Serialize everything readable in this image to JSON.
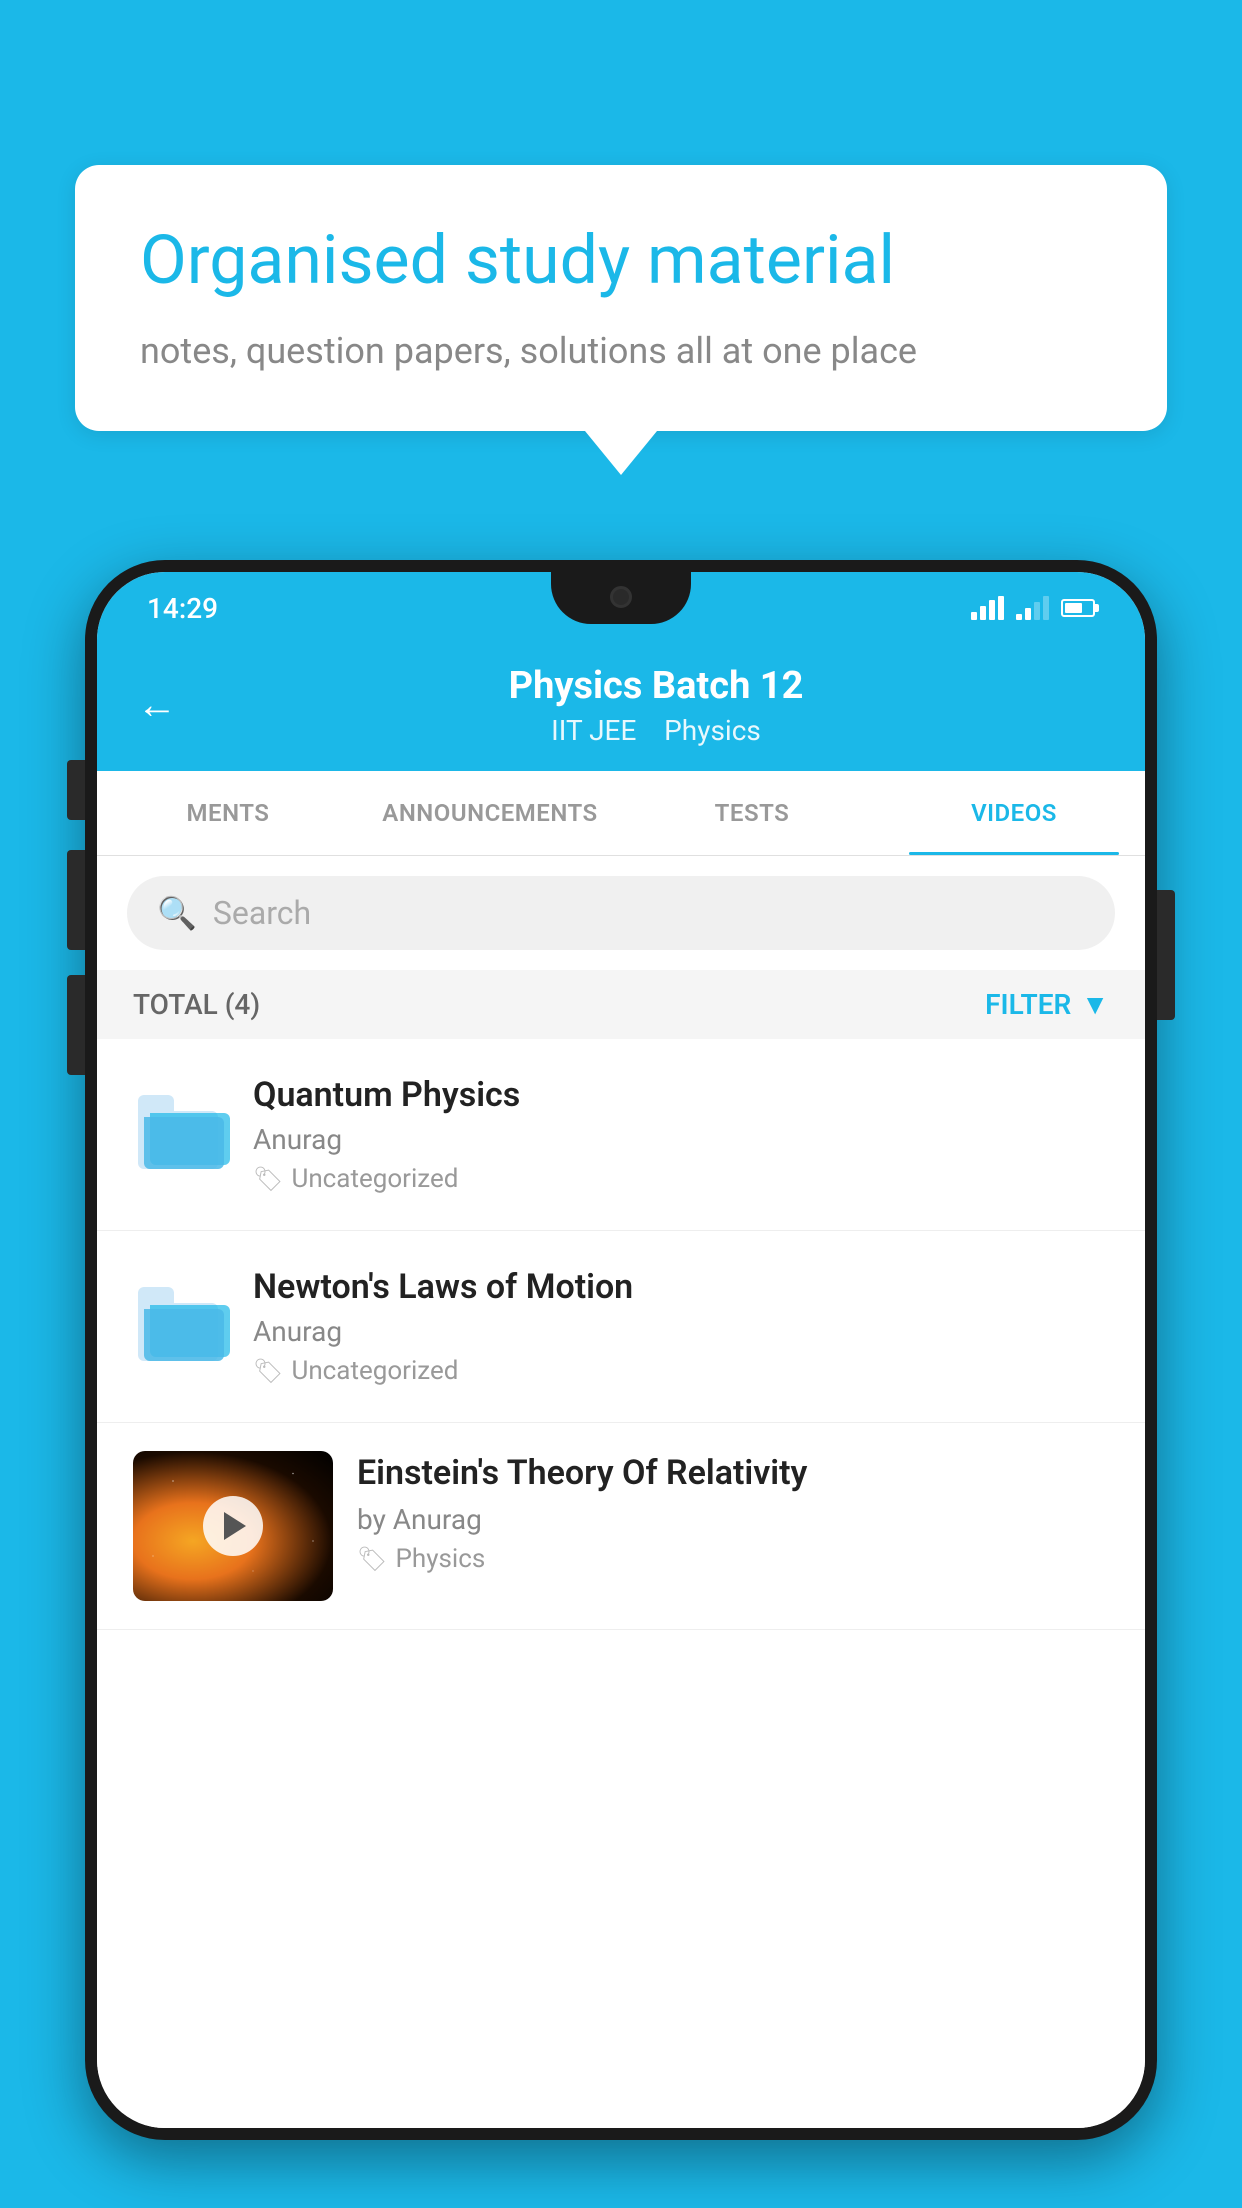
{
  "background": {
    "color": "#1BB8E8"
  },
  "speech_bubble": {
    "title": "Organised study material",
    "subtitle": "notes, question papers, solutions all at one place"
  },
  "phone": {
    "status_bar": {
      "time": "14:29",
      "wifi": true,
      "signal": true,
      "battery": true
    },
    "header": {
      "back_label": "←",
      "title": "Physics Batch 12",
      "subtitle_tag1": "IIT JEE",
      "subtitle_tag2": "Physics"
    },
    "tabs": [
      {
        "label": "MENTS",
        "active": false
      },
      {
        "label": "ANNOUNCEMENTS",
        "active": false
      },
      {
        "label": "TESTS",
        "active": false
      },
      {
        "label": "VIDEOS",
        "active": true
      }
    ],
    "search": {
      "placeholder": "Search"
    },
    "filter_row": {
      "total_label": "TOTAL (4)",
      "filter_label": "FILTER"
    },
    "videos": [
      {
        "id": "video-1",
        "title": "Quantum Physics",
        "author": "Anurag",
        "tag": "Uncategorized",
        "has_thumbnail": false
      },
      {
        "id": "video-2",
        "title": "Newton's Laws of Motion",
        "author": "Anurag",
        "tag": "Uncategorized",
        "has_thumbnail": false
      },
      {
        "id": "video-3",
        "title": "Einstein's Theory Of Relativity",
        "author": "by Anurag",
        "tag": "Physics",
        "has_thumbnail": true
      }
    ]
  }
}
